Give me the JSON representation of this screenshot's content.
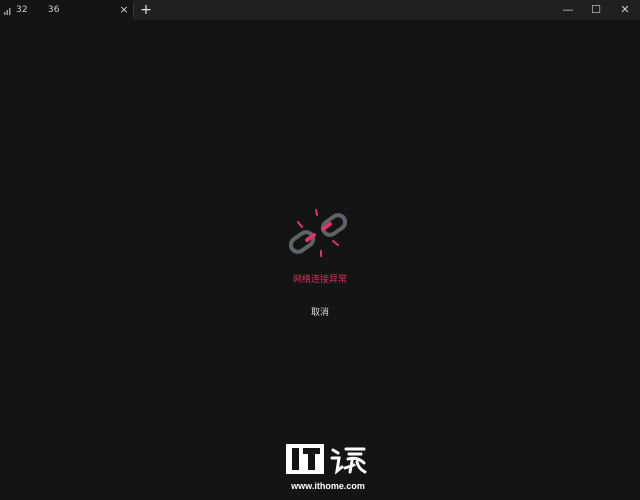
{
  "tab": {
    "title": "32          36",
    "icon": "signal-icon",
    "close_label": "×"
  },
  "toolbar": {
    "new_tab_label": "+"
  },
  "window_controls": {
    "minimize": "—",
    "maximize": "☐",
    "close": "✕"
  },
  "error": {
    "icon": "broken-link-icon",
    "message": "网络连接异常",
    "cancel_label": "取消",
    "accent_color": "#d6315a"
  },
  "watermark": {
    "url": "www.ithome.com"
  }
}
